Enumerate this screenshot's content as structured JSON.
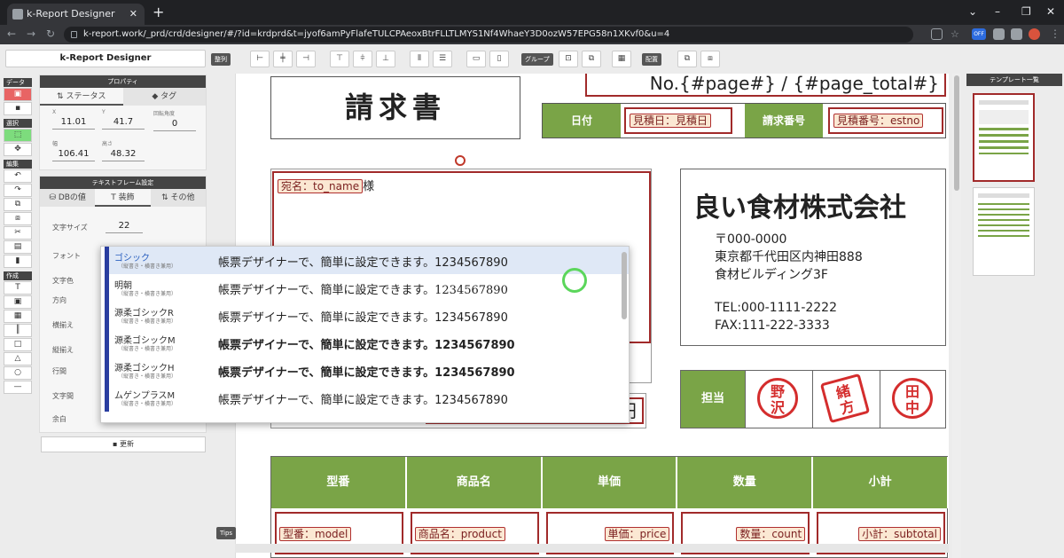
{
  "browser": {
    "tab_title": "k-Report Designer",
    "url": "k-report.work/_prd/crd/designer/#/?id=krdprd&t=jyof6amPyFlafeTULCPAeoxBtrFLLTLMYS1Nf4WhaeY3D0ozW57EPG58n1XKvf0&u=4",
    "ext_badge": "OFF"
  },
  "app": {
    "logo_text": "k-Report Designer",
    "toolbar": {
      "align_label": "整列",
      "group_label": "グループ",
      "arrange_label": "配置"
    },
    "rail": {
      "data_label": "データ",
      "select_label": "選択",
      "edit_label": "編集",
      "create_label": "作成"
    },
    "properties": {
      "title": "プロパティ",
      "tab_status": "ステータス",
      "tab_tag": "タグ",
      "x_label": "X",
      "x_value": "11.01",
      "y_label": "Y",
      "y_value": "41.7",
      "rot_label": "回転角度",
      "rot_value": "0",
      "w_label": "幅",
      "w_value": "106.41",
      "h_label": "高さ",
      "h_value": "48.32"
    },
    "textframe": {
      "title": "テキストフレーム設定",
      "tab_db": "DBの値",
      "tab_deco": "装飾",
      "tab_other": "その他",
      "font_size_label": "文字サイズ",
      "font_size_value": "22",
      "font_label": "フォント",
      "color_label": "文字色",
      "direction_label": "方向",
      "halign_label": "横揃え",
      "valign_label": "縦揃え",
      "line_label": "行間",
      "spacing_label": "文字間",
      "margin_label": "余白",
      "update_label": "更新"
    },
    "template_panel_title": "テンプレート一覧",
    "tips_label": "Tips"
  },
  "font_dropdown": {
    "sample_text": "帳票デザイナーで、簡単に設定できます。1234567890",
    "options": [
      {
        "name": "ゴシック",
        "note": "（縦書き・横書き兼用）"
      },
      {
        "name": "明朝",
        "note": "（縦書き・横書き兼用）"
      },
      {
        "name": "源柔ゴシックR",
        "note": "（縦書き・横書き兼用）"
      },
      {
        "name": "源柔ゴシックM",
        "note": "（縦書き・横書き兼用）"
      },
      {
        "name": "源柔ゴシックH",
        "note": "（縦書き・横書き兼用）"
      },
      {
        "name": "ムゲンプラスM",
        "note": "（縦書き・横書き兼用）"
      }
    ]
  },
  "document": {
    "title": "請求書",
    "page_no": "No.{#page#} / {#page_total#}",
    "date_label": "日付",
    "date_tag": "見積日：見積日",
    "number_label": "請求番号",
    "number_tag": "見積番号：estno",
    "to_tag": "宛名：to_name",
    "to_suffix": "様",
    "company_name": "良い食材株式会社",
    "postal": "〒000-0000",
    "address1": "東京都千代田区内神田888",
    "address2": "食材ビルディング3F",
    "tel": "TEL:000-1111-2222",
    "fax": "FAX:111-222-3333",
    "tantou_label": "担当",
    "stamps": [
      "野沢",
      "緒方",
      "田中"
    ],
    "yen_char": "円",
    "table_headers": [
      "型番",
      "商品名",
      "単価",
      "数量",
      "小計"
    ],
    "row_tags": [
      "型番：model",
      "商品名：product",
      "単価：price",
      "数量：count",
      "小計：subtotal"
    ]
  }
}
